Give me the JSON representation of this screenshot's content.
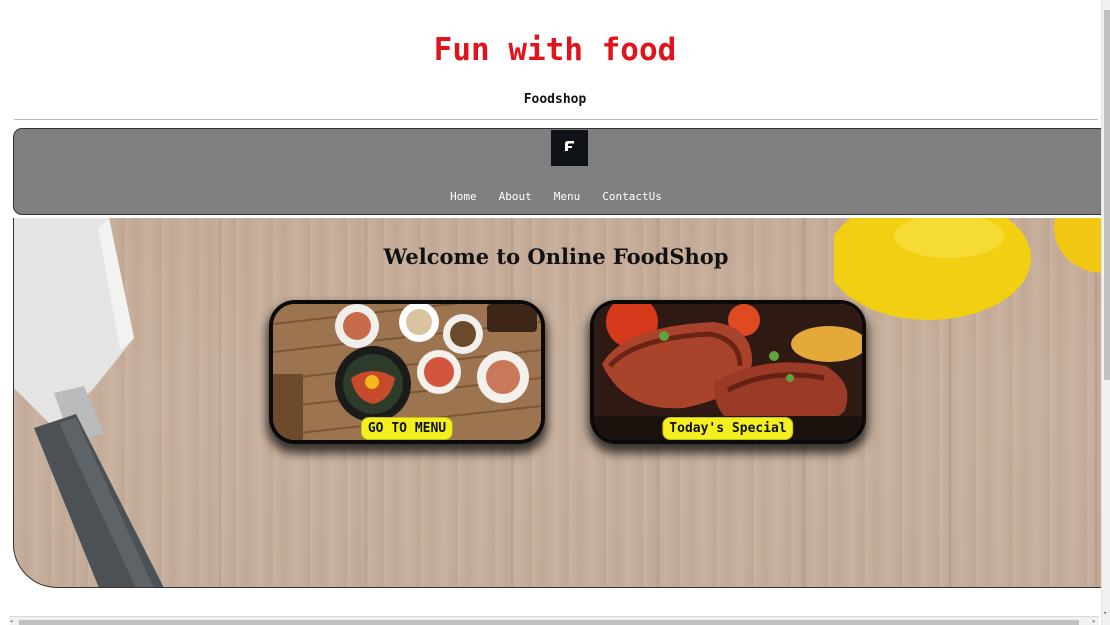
{
  "header": {
    "title": "Fun with food",
    "subtitle": "Foodshop"
  },
  "nav": {
    "logo_icon": "brand-logo-icon",
    "links": [
      "Home",
      "About",
      "Menu",
      "ContactUs"
    ]
  },
  "hero": {
    "heading": "Welcome to Online FoodShop",
    "cards": [
      {
        "label": "GO TO MENU",
        "image": "korean-meal-table-photo"
      },
      {
        "label": "Today's Special",
        "image": "grilled-steak-photo"
      }
    ]
  },
  "colors": {
    "title": "#e0141a",
    "navbar": "#7f7f7f",
    "badge": "#f4ef1e",
    "wood": "#c6ac98"
  }
}
